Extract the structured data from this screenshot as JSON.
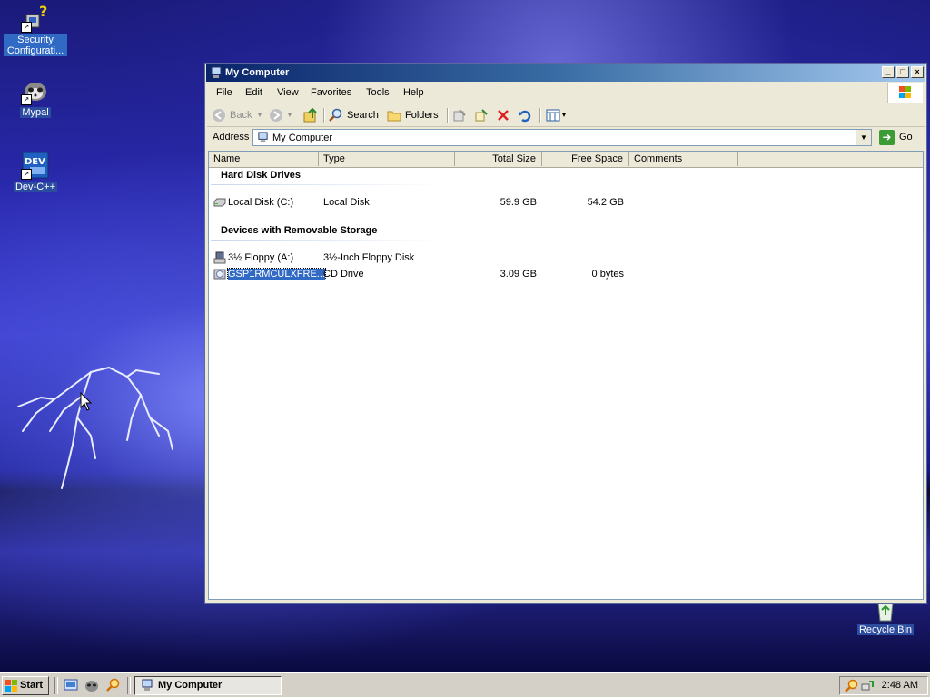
{
  "desktop": {
    "icons": [
      {
        "label": "Security Configurati...",
        "icon": "security-config-icon"
      },
      {
        "label": "Mypal",
        "icon": "mypal-icon"
      },
      {
        "label": "Dev-C++",
        "icon": "devcpp-icon"
      },
      {
        "label": "Recycle Bin",
        "icon": "recycle-bin-icon"
      }
    ],
    "dev_badge": "DEV"
  },
  "window": {
    "title": "My Computer",
    "menu": [
      "File",
      "Edit",
      "View",
      "Favorites",
      "Tools",
      "Help"
    ],
    "toolbar": {
      "back": "Back",
      "search": "Search",
      "folders": "Folders"
    },
    "address": {
      "label": "Address",
      "value": "My Computer",
      "go": "Go"
    },
    "columns": [
      "Name",
      "Type",
      "Total Size",
      "Free Space",
      "Comments"
    ],
    "groups": [
      {
        "title": "Hard Disk Drives",
        "items": [
          {
            "name": "Local Disk (C:)",
            "type": "Local Disk",
            "total": "59.9 GB",
            "free": "54.2 GB",
            "icon": "hard-disk-icon"
          }
        ]
      },
      {
        "title": "Devices with Removable Storage",
        "items": [
          {
            "name": "3½ Floppy (A:)",
            "type": "3½-Inch Floppy Disk",
            "total": "",
            "free": "",
            "icon": "floppy-drive-icon"
          },
          {
            "name": "GSP1RMCULXFRE...",
            "type": "CD Drive",
            "total": "3.09 GB",
            "free": "0 bytes",
            "icon": "cd-drive-icon",
            "selected": true
          }
        ]
      }
    ]
  },
  "taskbar": {
    "start": "Start",
    "task": "My Computer",
    "clock": "2:48 AM"
  },
  "colors": {
    "title_start": "#0a246a",
    "title_end": "#a6caf0",
    "selection": "#316ac5",
    "face": "#ece9d8"
  }
}
